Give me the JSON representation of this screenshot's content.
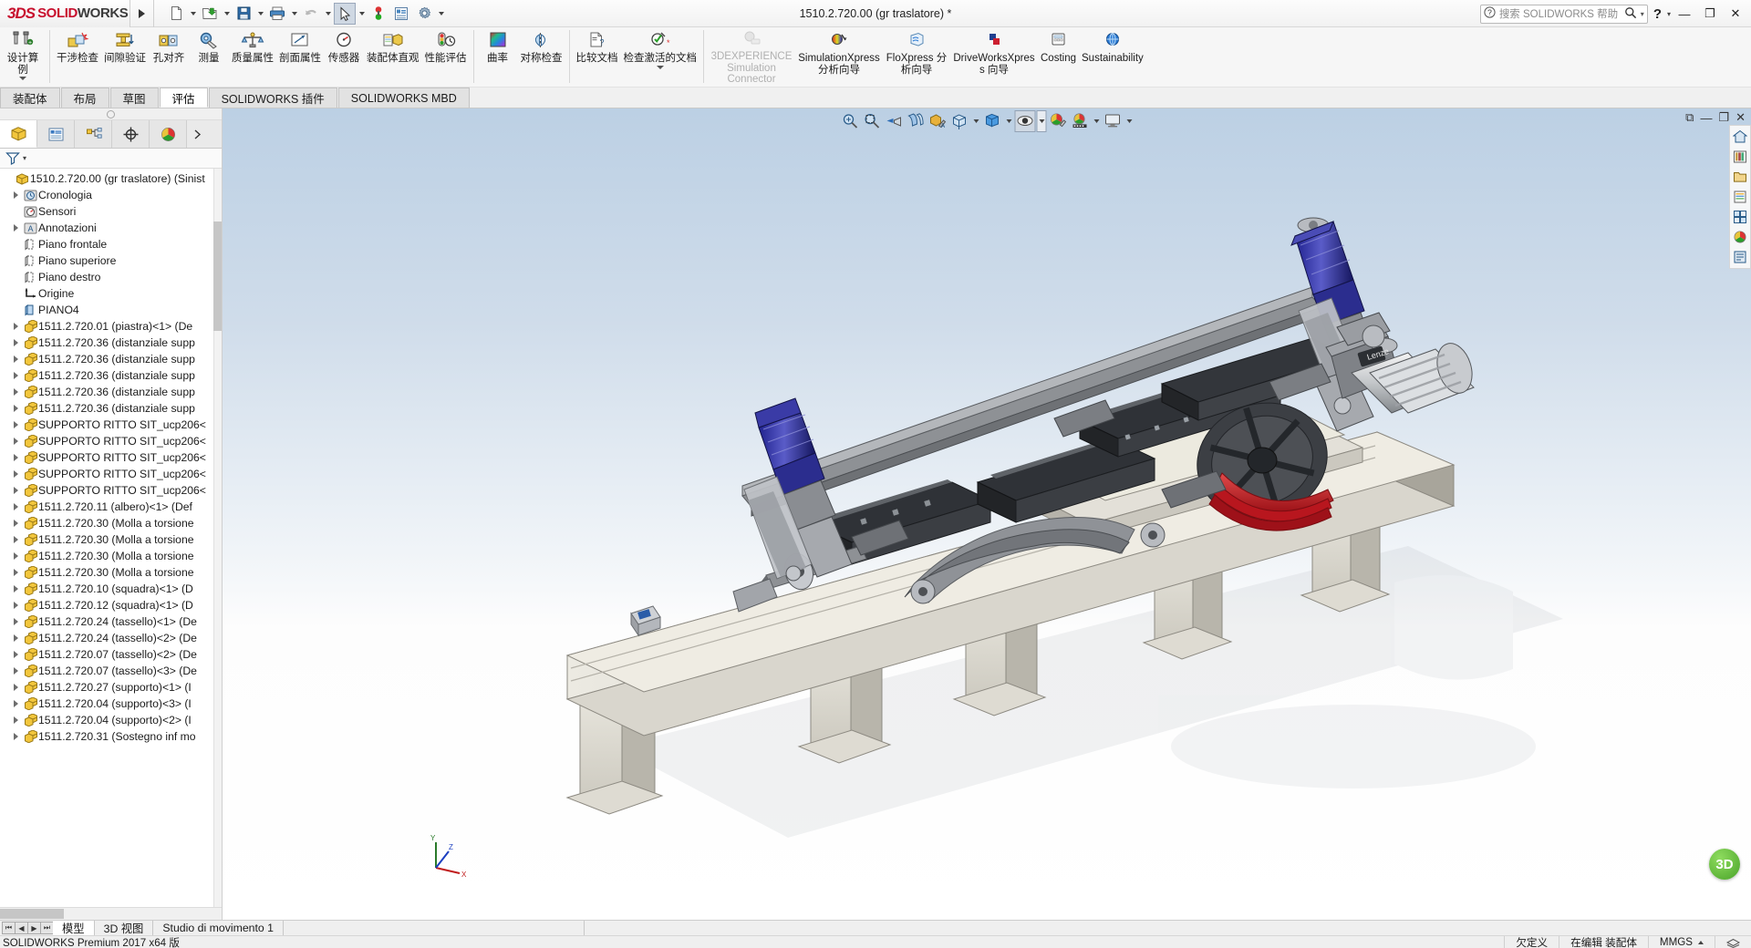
{
  "titlebar": {
    "brand_3ds": "3DS",
    "brand_solid": "SOLID",
    "brand_works": "WORKS",
    "document_title": "1510.2.720.00 (gr traslatore) *",
    "help_placeholder": "搜索 SOLIDWORKS 帮助",
    "help_question": "?",
    "minimize": "—",
    "restore": "❐",
    "close": "✕",
    "quick_access": [
      {
        "name": "new-document-icon",
        "caret": true
      },
      {
        "name": "open-document-icon",
        "caret": true
      },
      {
        "name": "save-icon",
        "caret": true
      },
      {
        "name": "print-icon",
        "caret": true
      },
      {
        "name": "undo-icon",
        "caret": true
      },
      {
        "name": "select-arrow-icon",
        "caret": true,
        "selected": true
      },
      {
        "name": "rebuild-icon",
        "caret": false
      },
      {
        "name": "file-properties-icon",
        "caret": false
      },
      {
        "name": "options-gear-icon",
        "caret": true
      }
    ]
  },
  "ribbon": {
    "groups": [
      {
        "buttons": [
          {
            "id": "design-study",
            "label": "设计算例",
            "icon": "design-study-icon",
            "dropdown": true,
            "disabled": false
          }
        ]
      },
      {
        "buttons": [
          {
            "id": "interference-detection",
            "label": "干涉检查",
            "icon": "interference-icon",
            "dropdown": false,
            "disabled": false
          },
          {
            "id": "clearance-verification",
            "label": "间隙验证",
            "icon": "clearance-icon",
            "dropdown": false,
            "disabled": false
          },
          {
            "id": "hole-alignment",
            "label": "孔对齐",
            "icon": "hole-align-icon",
            "dropdown": false,
            "disabled": false
          },
          {
            "id": "measure",
            "label": "测量",
            "icon": "measure-icon",
            "dropdown": false,
            "disabled": false
          },
          {
            "id": "mass-properties",
            "label": "质量属性",
            "icon": "mass-properties-icon",
            "dropdown": false,
            "disabled": false
          },
          {
            "id": "section-properties",
            "label": "剖面属性",
            "icon": "section-properties-icon",
            "dropdown": false,
            "disabled": false
          },
          {
            "id": "sensor",
            "label": "传感器",
            "icon": "sensor-icon",
            "dropdown": false,
            "disabled": false
          },
          {
            "id": "assembly-visualization",
            "label": "装配体直观",
            "icon": "assembly-visualization-icon",
            "dropdown": false,
            "disabled": false
          },
          {
            "id": "performance-evaluation",
            "label": "性能评估",
            "icon": "performance-icon",
            "dropdown": false,
            "disabled": false
          }
        ]
      },
      {
        "buttons": [
          {
            "id": "curvature",
            "label": "曲率",
            "icon": "curvature-icon",
            "dropdown": false,
            "disabled": false
          },
          {
            "id": "symmetry-check",
            "label": "对称检查",
            "icon": "symmetry-check-icon",
            "dropdown": false,
            "disabled": false
          }
        ]
      },
      {
        "buttons": [
          {
            "id": "compare-documents",
            "label": "比较文档",
            "icon": "compare-documents-icon",
            "dropdown": false,
            "disabled": false
          },
          {
            "id": "check-active-document",
            "label": "检查激活的文档",
            "icon": "check-active-document-icon",
            "dropdown": true,
            "disabled": false
          }
        ]
      },
      {
        "buttons": [
          {
            "id": "3dexperience-simulation-connector",
            "label": "3DEXPERIENCE Simulation Connector",
            "icon": "3dexperience-icon",
            "dropdown": false,
            "disabled": true
          },
          {
            "id": "simulationxpress",
            "label": "SimulationXpress 分析向导",
            "icon": "simulationxpress-icon",
            "dropdown": false,
            "disabled": false
          },
          {
            "id": "floxpress",
            "label": "FloXpress 分析向导",
            "icon": "floxpress-icon",
            "dropdown": false,
            "disabled": false
          },
          {
            "id": "driveworksxpress",
            "label": "DriveWorksXpress 向导",
            "icon": "driveworksxpress-icon",
            "dropdown": false,
            "disabled": false
          },
          {
            "id": "costing",
            "label": "Costing",
            "icon": "costing-icon",
            "dropdown": false,
            "disabled": false
          },
          {
            "id": "sustainability",
            "label": "Sustainability",
            "icon": "sustainability-icon",
            "dropdown": false,
            "disabled": false
          }
        ]
      }
    ]
  },
  "command_tabs": [
    {
      "label": "装配体",
      "active": false
    },
    {
      "label": "布局",
      "active": false
    },
    {
      "label": "草图",
      "active": false
    },
    {
      "label": "评估",
      "active": true
    },
    {
      "label": "SOLIDWORKS 插件",
      "active": false
    },
    {
      "label": "SOLIDWORKS MBD",
      "active": false
    }
  ],
  "left_panel": {
    "tabs": [
      {
        "name": "feature-manager-tab",
        "icon": "yellow-box-icon",
        "active": true
      },
      {
        "name": "property-manager-tab",
        "icon": "property-list-icon",
        "active": false
      },
      {
        "name": "configuration-manager-tab",
        "icon": "configuration-icon",
        "active": false
      },
      {
        "name": "dimxpert-manager-tab",
        "icon": "dimxpert-icon",
        "active": false
      },
      {
        "name": "display-manager-tab",
        "icon": "display-sphere-icon",
        "active": false
      }
    ],
    "filter_icon": "filter-icon",
    "tree": [
      {
        "label": "1510.2.720.00 (gr traslatore)  (Sinist",
        "icon": "assembly-icon",
        "indent": 0,
        "arrow": false,
        "root": true
      },
      {
        "label": "Cronologia",
        "icon": "history-folder-icon",
        "indent": 1,
        "arrow": true
      },
      {
        "label": "Sensori",
        "icon": "sensors-folder-icon",
        "indent": 1,
        "arrow": false
      },
      {
        "label": "Annotazioni",
        "icon": "annotations-folder-icon",
        "indent": 1,
        "arrow": true
      },
      {
        "label": "Piano frontale",
        "icon": "plane-icon",
        "indent": 1,
        "arrow": false
      },
      {
        "label": "Piano superiore",
        "icon": "plane-icon",
        "indent": 1,
        "arrow": false
      },
      {
        "label": "Piano destro",
        "icon": "plane-icon",
        "indent": 1,
        "arrow": false
      },
      {
        "label": "Origine",
        "icon": "origin-icon",
        "indent": 1,
        "arrow": false
      },
      {
        "label": "PIANO4",
        "icon": "plane-blue-icon",
        "indent": 1,
        "arrow": false
      },
      {
        "label": "1511.2.720.01 (piastra)<1> (De",
        "icon": "part-icon",
        "indent": 1,
        "arrow": true
      },
      {
        "label": "1511.2.720.36 (distanziale supp",
        "icon": "part-icon",
        "indent": 1,
        "arrow": true
      },
      {
        "label": "1511.2.720.36 (distanziale supp",
        "icon": "part-icon",
        "indent": 1,
        "arrow": true
      },
      {
        "label": "1511.2.720.36 (distanziale supp",
        "icon": "part-icon",
        "indent": 1,
        "arrow": true
      },
      {
        "label": "1511.2.720.36 (distanziale supp",
        "icon": "part-icon",
        "indent": 1,
        "arrow": true
      },
      {
        "label": "1511.2.720.36 (distanziale supp",
        "icon": "part-icon",
        "indent": 1,
        "arrow": true
      },
      {
        "label": "SUPPORTO RITTO SIT_ucp206<",
        "icon": "part-icon",
        "indent": 1,
        "arrow": true
      },
      {
        "label": "SUPPORTO RITTO SIT_ucp206<",
        "icon": "part-icon",
        "indent": 1,
        "arrow": true
      },
      {
        "label": "SUPPORTO RITTO SIT_ucp206<",
        "icon": "part-icon",
        "indent": 1,
        "arrow": true
      },
      {
        "label": "SUPPORTO RITTO SIT_ucp206<",
        "icon": "part-icon",
        "indent": 1,
        "arrow": true
      },
      {
        "label": "SUPPORTO RITTO SIT_ucp206<",
        "icon": "part-icon",
        "indent": 1,
        "arrow": true
      },
      {
        "label": "1511.2.720.11 (albero)<1> (Def",
        "icon": "part-icon",
        "indent": 1,
        "arrow": true
      },
      {
        "label": "1511.2.720.30 (Molla a torsione",
        "icon": "part-icon",
        "indent": 1,
        "arrow": true
      },
      {
        "label": "1511.2.720.30 (Molla a torsione",
        "icon": "part-icon",
        "indent": 1,
        "arrow": true
      },
      {
        "label": "1511.2.720.30 (Molla a torsione",
        "icon": "part-icon",
        "indent": 1,
        "arrow": true
      },
      {
        "label": "1511.2.720.30 (Molla a torsione",
        "icon": "part-icon",
        "indent": 1,
        "arrow": true
      },
      {
        "label": "1511.2.720.10 (squadra)<1> (D",
        "icon": "part-icon",
        "indent": 1,
        "arrow": true
      },
      {
        "label": "1511.2.720.12 (squadra)<1> (D",
        "icon": "part-icon",
        "indent": 1,
        "arrow": true
      },
      {
        "label": "1511.2.720.24 (tassello)<1> (De",
        "icon": "part-icon",
        "indent": 1,
        "arrow": true
      },
      {
        "label": "1511.2.720.24 (tassello)<2> (De",
        "icon": "part-icon",
        "indent": 1,
        "arrow": true
      },
      {
        "label": "1511.2.720.07 (tassello)<2> (De",
        "icon": "part-icon",
        "indent": 1,
        "arrow": true
      },
      {
        "label": "1511.2.720.07 (tassello)<3> (De",
        "icon": "part-icon",
        "indent": 1,
        "arrow": true
      },
      {
        "label": "1511.2.720.27 (supporto)<1> (I",
        "icon": "part-icon",
        "indent": 1,
        "arrow": true
      },
      {
        "label": "1511.2.720.04 (supporto)<3> (I",
        "icon": "part-icon",
        "indent": 1,
        "arrow": true
      },
      {
        "label": "1511.2.720.04 (supporto)<2> (I",
        "icon": "part-icon",
        "indent": 1,
        "arrow": true
      },
      {
        "label": "1511.2.720.31 (Sostegno inf mo",
        "icon": "part-icon",
        "indent": 1,
        "arrow": true
      }
    ]
  },
  "view_toolbar": [
    {
      "name": "zoom-to-fit-icon",
      "caret": false,
      "selected": false
    },
    {
      "name": "zoom-to-area-icon",
      "caret": false,
      "selected": false
    },
    {
      "name": "previous-view-icon",
      "caret": false,
      "selected": false
    },
    {
      "name": "section-view-icon",
      "caret": false,
      "selected": false
    },
    {
      "name": "view-orientation-paint-icon",
      "caret": false,
      "selected": false
    },
    {
      "name": "view-orientation-icon",
      "caret": true,
      "selected": false
    },
    {
      "name": "display-style-icon",
      "caret": true,
      "selected": false
    },
    {
      "name": "hide-show-items-icon",
      "caret": true,
      "selected": true,
      "boxedcaret": true
    },
    {
      "name": "edit-appearance-icon",
      "caret": false,
      "selected": false
    },
    {
      "name": "apply-scene-icon",
      "caret": true,
      "selected": false
    },
    {
      "name": "view-settings-icon",
      "caret": true,
      "selected": false
    }
  ],
  "right_dock": [
    {
      "name": "home-icon"
    },
    {
      "name": "design-library-icon"
    },
    {
      "name": "file-explorer-icon"
    },
    {
      "name": "search-library-icon"
    },
    {
      "name": "view-palette-icon"
    },
    {
      "name": "appearances-icon"
    },
    {
      "name": "custom-properties-icon"
    }
  ],
  "viewport_window_controls": {
    "restore_small": "⧉",
    "minimize": "—",
    "restore": "❐",
    "close": "✕"
  },
  "triad": {
    "x": "X",
    "y": "Y",
    "z": "Z"
  },
  "badge": "3D",
  "bottom_tabs": {
    "nav": [
      "⏮",
      "◀",
      "▶",
      "⏭"
    ],
    "tabs": [
      {
        "label": "模型",
        "active": true
      },
      {
        "label": "3D 视图",
        "active": false
      },
      {
        "label": "Studio di movimento 1",
        "active": false
      }
    ]
  },
  "status_bar": {
    "left": "SOLIDWORKS Premium 2017 x64 版",
    "state": "欠定义",
    "editing": "在编辑 装配体",
    "units": "MMGS",
    "overlay_icon": "layers-icon"
  },
  "colors": {
    "accent_red": "#c8102e",
    "selection_blue": "#cfd8e3",
    "part_yellow": "#f0c020",
    "motor_blue": "#2f2f9e",
    "pulley_red": "#c0151d"
  }
}
